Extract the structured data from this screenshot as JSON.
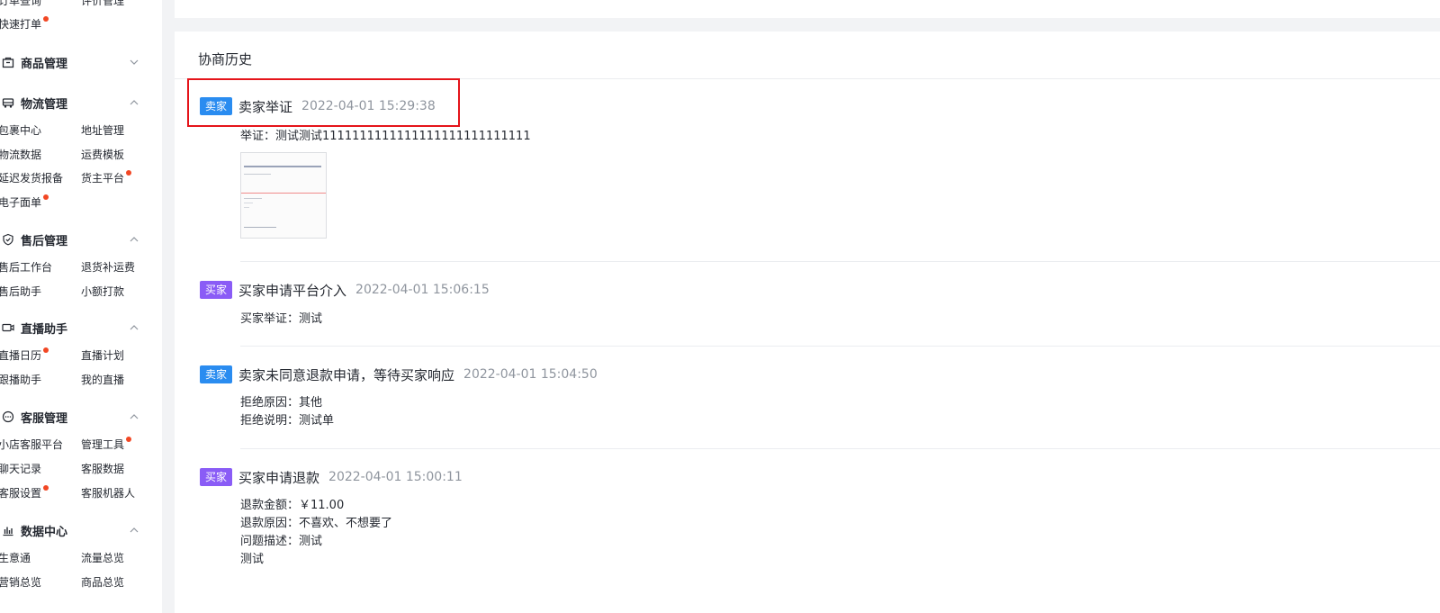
{
  "sidebar": {
    "top_links": [
      {
        "label": "订单查询",
        "dot": false
      },
      {
        "label": "评价管理",
        "dot": false
      },
      {
        "label": "快速打单",
        "dot": true
      }
    ],
    "groups": [
      {
        "title": "商品管理",
        "icon": "product-bag-icon",
        "expanded": false,
        "items": []
      },
      {
        "title": "物流管理",
        "icon": "truck-icon",
        "expanded": true,
        "items": [
          {
            "label": "包裹中心",
            "dot": false
          },
          {
            "label": "地址管理",
            "dot": false
          },
          {
            "label": "物流数据",
            "dot": false
          },
          {
            "label": "运费模板",
            "dot": false
          },
          {
            "label": "延迟发货报备",
            "dot": false
          },
          {
            "label": "货主平台",
            "dot": true
          },
          {
            "label": "电子面单",
            "dot": true
          }
        ]
      },
      {
        "title": "售后管理",
        "icon": "shield-check-icon",
        "expanded": true,
        "items": [
          {
            "label": "售后工作台",
            "dot": false
          },
          {
            "label": "退货补运费",
            "dot": false
          },
          {
            "label": "售后助手",
            "dot": false
          },
          {
            "label": "小额打款",
            "dot": false
          }
        ]
      },
      {
        "title": "直播助手",
        "icon": "video-camera-icon",
        "expanded": true,
        "items": [
          {
            "label": "直播日历",
            "dot": true
          },
          {
            "label": "直播计划",
            "dot": false
          },
          {
            "label": "跟播助手",
            "dot": false
          },
          {
            "label": "我的直播",
            "dot": false
          }
        ]
      },
      {
        "title": "客服管理",
        "icon": "chat-bubble-icon",
        "expanded": true,
        "items": [
          {
            "label": "小店客服平台",
            "dot": false
          },
          {
            "label": "管理工具",
            "dot": true
          },
          {
            "label": "聊天记录",
            "dot": false
          },
          {
            "label": "客服数据",
            "dot": false
          },
          {
            "label": "客服设置",
            "dot": true
          },
          {
            "label": "客服机器人",
            "dot": false
          }
        ]
      },
      {
        "title": "数据中心",
        "icon": "bar-chart-icon",
        "expanded": true,
        "items": [
          {
            "label": "生意通",
            "dot": false
          },
          {
            "label": "流量总览",
            "dot": false
          },
          {
            "label": "营销总览",
            "dot": false
          },
          {
            "label": "商品总览",
            "dot": false
          }
        ]
      }
    ]
  },
  "panel": {
    "title": "协商历史",
    "entries": [
      {
        "role": "卖家",
        "role_type": "seller",
        "title": "卖家举证",
        "time": "2022-04-01 15:29:38",
        "lines": [
          "举证：测试测试1111111111111111111111111111"
        ],
        "has_image": true
      },
      {
        "role": "买家",
        "role_type": "buyer",
        "title": "买家申请平台介入",
        "time": "2022-04-01 15:06:15",
        "lines": [
          "买家举证：测试"
        ],
        "has_image": false
      },
      {
        "role": "卖家",
        "role_type": "seller",
        "title": "卖家未同意退款申请，等待买家响应",
        "time": "2022-04-01 15:04:50",
        "lines": [
          "拒绝原因：其他",
          "拒绝说明：测试单"
        ],
        "has_image": false
      },
      {
        "role": "买家",
        "role_type": "buyer",
        "title": "买家申请退款",
        "time": "2022-04-01 15:00:11",
        "lines": [
          "退款金额：￥11.00",
          "退款原因：不喜欢、不想要了",
          "问题描述：测试",
          "测试"
        ],
        "has_image": false
      }
    ]
  },
  "colors": {
    "seller_badge": "#2a8cf0",
    "buyer_badge": "#8a5cf6",
    "notify_dot": "#f24724",
    "highlight_box": "#e5141a"
  }
}
